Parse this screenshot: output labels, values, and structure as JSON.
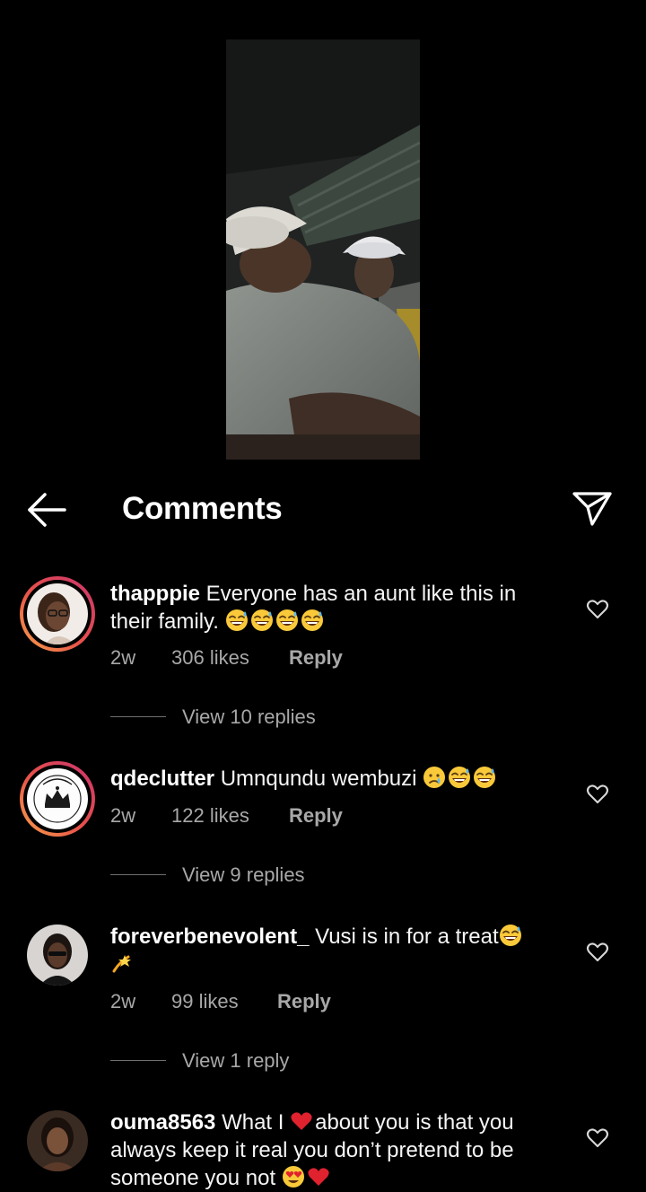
{
  "header": {
    "title": "Comments",
    "back_icon": "arrow-left-icon",
    "share_icon": "paper-plane-icon"
  },
  "comments": [
    {
      "username": "thapppie",
      "text": "Everyone has an aunt like this in their family.",
      "emojis": [
        "grinning-sweat",
        "grinning-sweat",
        "grinning-sweat",
        "grinning-sweat"
      ],
      "time": "2w",
      "likes": "306 likes",
      "reply": "Reply",
      "view_replies": "View 10 replies",
      "has_story_ring": true
    },
    {
      "username": "qdeclutter",
      "text": "Umnqundu wembuzi",
      "emojis": [
        "crying",
        "grinning-sweat",
        "grinning-sweat"
      ],
      "time": "2w",
      "likes": "122 likes",
      "reply": "Reply",
      "view_replies": "View 9 replies",
      "has_story_ring": true
    },
    {
      "username": "foreverbenevolent_",
      "text": "Vusi is in for a treat",
      "emojis": [
        "grinning-sweat",
        "dizzy"
      ],
      "time": "2w",
      "likes": "99 likes",
      "reply": "Reply",
      "view_replies": "View 1 reply",
      "has_story_ring": false
    },
    {
      "username": "ouma8563",
      "text_part1": "What I",
      "text_part2": "about you is that you always keep it real you don’t pretend to be someone you not",
      "emojis": [
        "red-heart",
        "heart-eyes",
        "red-heart"
      ],
      "has_story_ring": false
    }
  ],
  "colors": {
    "background": "#000000",
    "text": "#ffffff",
    "muted": "#a8a8a8",
    "story_ring_start": "#f7a34b",
    "story_ring_end": "#c9346d"
  }
}
